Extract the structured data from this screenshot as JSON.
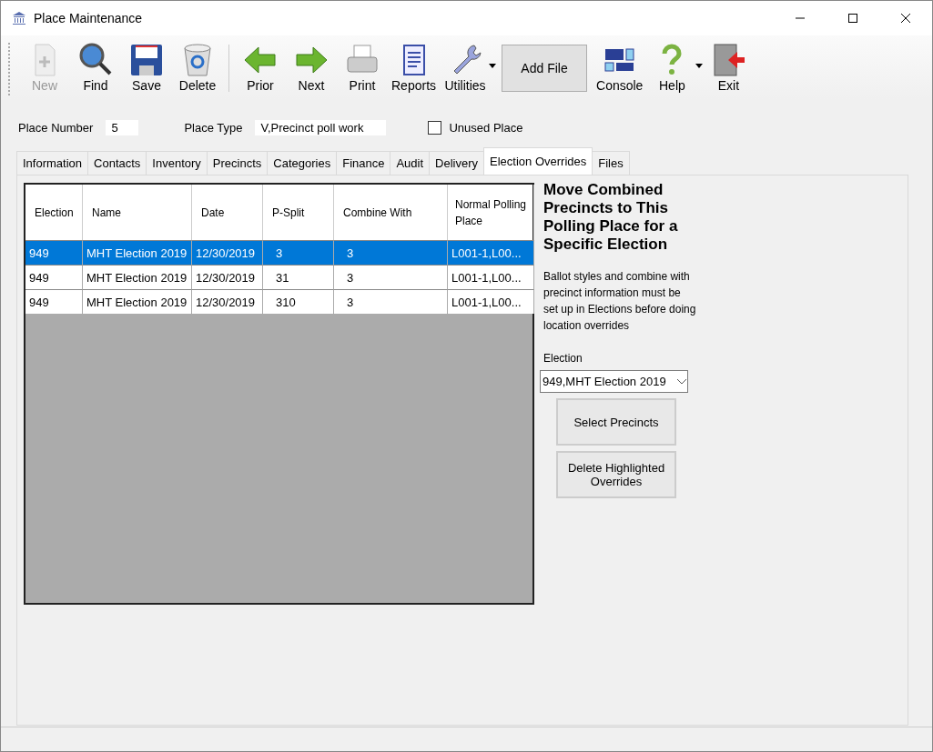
{
  "window": {
    "title": "Place Maintenance"
  },
  "toolbar": [
    {
      "kind": "new",
      "label": "New",
      "disabled": true,
      "menu": false
    },
    {
      "kind": "find",
      "label": "Find",
      "disabled": false,
      "menu": false
    },
    {
      "kind": "save",
      "label": "Save",
      "disabled": false,
      "menu": false
    },
    {
      "kind": "delete",
      "label": "Delete",
      "disabled": false,
      "menu": false
    },
    {
      "kind": "separator"
    },
    {
      "kind": "prior",
      "label": "Prior",
      "disabled": false,
      "menu": false
    },
    {
      "kind": "next",
      "label": "Next",
      "disabled": false,
      "menu": false
    },
    {
      "kind": "print",
      "label": "Print",
      "disabled": false,
      "menu": false
    },
    {
      "kind": "reports",
      "label": "Reports",
      "disabled": false,
      "menu": false
    },
    {
      "kind": "utilities",
      "label": "Utilities",
      "disabled": false,
      "menu": true
    },
    {
      "kind": "text",
      "label": "Add File"
    },
    {
      "kind": "console",
      "label": "Console",
      "disabled": false,
      "menu": false
    },
    {
      "kind": "help",
      "label": "Help",
      "disabled": false,
      "menu": true
    },
    {
      "kind": "exit",
      "label": "Exit",
      "disabled": false,
      "menu": false
    }
  ],
  "header": {
    "place_number_label": "Place Number",
    "place_number": "5",
    "place_type_label": "Place Type",
    "place_type": "V,Precinct poll work",
    "unused_label": "Unused Place",
    "unused_checked": false
  },
  "tabs": [
    {
      "label": "Information",
      "selected": false
    },
    {
      "label": "Contacts",
      "selected": false
    },
    {
      "label": "Inventory",
      "selected": false
    },
    {
      "label": "Precincts",
      "selected": false
    },
    {
      "label": "Categories",
      "selected": false
    },
    {
      "label": "Finance",
      "selected": false
    },
    {
      "label": "Audit",
      "selected": false
    },
    {
      "label": "Delivery",
      "selected": false
    },
    {
      "label": "Election Overrides",
      "selected": true
    },
    {
      "label": "Files",
      "selected": false
    }
  ],
  "table": {
    "columns": [
      "Election",
      "Name",
      "Date",
      "P-Split",
      "Combine With",
      "Normal Polling Place"
    ],
    "rows": [
      {
        "cells": [
          "949",
          "MHT Election 2019",
          "12/30/2019",
          "3",
          "3",
          "L001-1,L00..."
        ],
        "selected": true
      },
      {
        "cells": [
          "949",
          "MHT Election 2019",
          "12/30/2019",
          "31",
          "3",
          "L001-1,L00..."
        ],
        "selected": false
      },
      {
        "cells": [
          "949",
          "MHT Election 2019",
          "12/30/2019",
          "310",
          "3",
          "L001-1,L00..."
        ],
        "selected": false
      }
    ]
  },
  "side": {
    "heading": "Move Combined Precincts to This Polling Place for a Specific Election",
    "note": "Ballot styles and combine with precinct information must be set up in Elections before doing location overrides",
    "election_label": "Election",
    "election_value": "949,MHT Election 2019",
    "buttons": [
      "Select Precincts",
      "Delete Highlighted Overrides"
    ]
  }
}
